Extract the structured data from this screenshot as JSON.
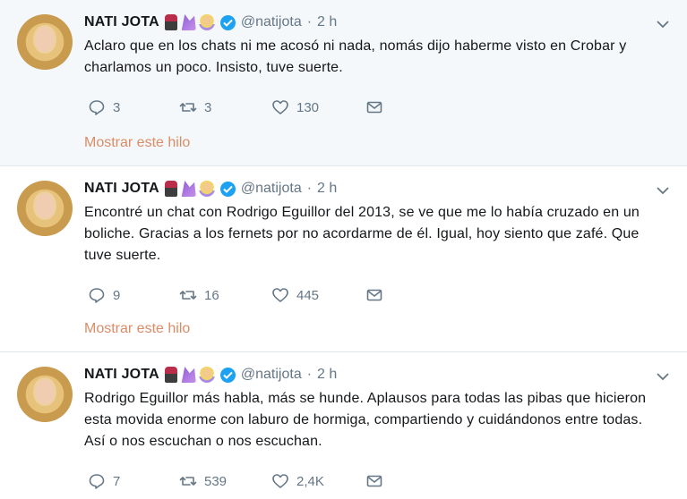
{
  "tweets": [
    {
      "name": "NATI JOTA",
      "handle": "@natijota",
      "dot": "·",
      "time": "2 h",
      "text": "Aclaro que en los chats ni me acosó ni nada, nomás dijo haberme visto en Crobar y charlamos un poco. Insisto, tuve suerte.",
      "replies": "3",
      "retweets": "3",
      "likes": "130",
      "show_thread": "Mostrar este hilo"
    },
    {
      "name": "NATI JOTA",
      "handle": "@natijota",
      "dot": "·",
      "time": "2 h",
      "text": "Encontré un chat con Rodrigo Eguillor del 2013, se ve que me lo había cruzado en un boliche. Gracias a los fernets por no acordarme de él. Igual, hoy siento que zafé. Que tuve suerte.",
      "replies": "9",
      "retweets": "16",
      "likes": "445",
      "show_thread": "Mostrar este hilo"
    },
    {
      "name": "NATI JOTA",
      "handle": "@natijota",
      "dot": "·",
      "time": "2 h",
      "text": "Rodrigo Eguillor más habla, más se hunde. Aplausos para todas las pibas que hicieron esta movida enorme con laburo de hormiga, compartiendo y cuidándonos entre todas. Así o nos escuchan o nos escuchan.",
      "replies": "7",
      "retweets": "539",
      "likes": "2,4K"
    }
  ],
  "icons": {
    "reply": "reply-icon",
    "retweet": "retweet-icon",
    "like": "heart-icon",
    "dm": "envelope-icon",
    "verified": "verified-badge-icon",
    "more": "chevron-down-icon"
  },
  "colors": {
    "highlight_bg": "#f5f8fa",
    "verified": "#1da1f2",
    "secondary_text": "#657786",
    "thread_link": "#d98c66"
  }
}
